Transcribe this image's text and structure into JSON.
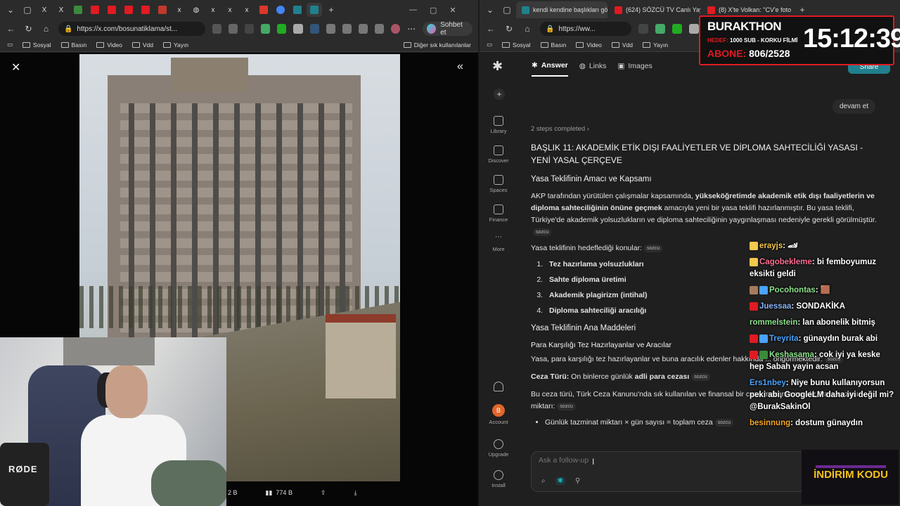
{
  "left_browser": {
    "tabs": [
      "X",
      "X",
      "U",
      "D",
      "K",
      "U",
      "R",
      "x",
      "x",
      "x",
      "x",
      "x",
      "A",
      "G",
      "(",
      "("
    ],
    "url": "https://x.com/bosunatiklama/st...",
    "copilot_label": "Sohbet et",
    "bookmarks": [
      "Sosyal",
      "Basın",
      "Video",
      "Vdd",
      "Yayın"
    ],
    "bookmarks_right": "Diğer sık kullanılanlar",
    "bottom_stats": {
      "stat1": "2 B",
      "views": "774 B"
    }
  },
  "right_browser": {
    "tabs": [
      {
        "title": "kendi kendine başlıkları gö",
        "color": "#20808d"
      },
      {
        "title": "(624) SÖZCÜ TV Canlı Yayı",
        "color": "#e01b22"
      },
      {
        "title": "(8) X'te Volkan: \"CV'e foto e",
        "color": "#e01b22"
      }
    ],
    "url": "https://ww...",
    "bookmarks": [
      "Sosyal",
      "Basın",
      "Video",
      "Vdd",
      "Yayın"
    ]
  },
  "sidebar": [
    {
      "label": "Library",
      "icon": "library-icon"
    },
    {
      "label": "Discover",
      "icon": "discover-icon"
    },
    {
      "label": "Spaces",
      "icon": "spaces-icon"
    },
    {
      "label": "Finance",
      "icon": "finance-icon"
    },
    {
      "label": "More",
      "icon": "more-icon"
    },
    {
      "label": "Account",
      "icon": "account-icon"
    },
    {
      "label": "Upgrade",
      "icon": "upgrade-icon"
    },
    {
      "label": "Install",
      "icon": "install-icon"
    }
  ],
  "avatar_letter": "B",
  "main_tabs": [
    "Answer",
    "Links",
    "Images"
  ],
  "share_label": "Share",
  "user_query": "devam et",
  "steps_label": "2 steps completed",
  "answer": {
    "title": "BAŞLIK 11: AKADEMİK ETİK DIŞI FAALİYETLER VE DİPLOMA SAHTECİLİĞİ YASASI - YENİ YASAL ÇERÇEVE",
    "h_purpose": "Yasa Teklifinin Amacı ve Kapsamı",
    "p1_a": "AKP tarafından yürütülen çalışmalar kapsamında, ",
    "p1_b": "yükseköğretimde akademik etik dışı faaliyetlerin ve diploma sahteciliğinin önüne geçmek",
    "p1_c": " amacıyla yeni bir yasa teklifi hazırlanmıştır. Bu yasa teklifi, Türkiye'de akademik yolsuzlukların ve diploma sahteciliğinin yaygınlaşması nedeniyle gerekli görülmüştür.",
    "cite": "sozcu",
    "p2": "Yasa teklifinin hedeflediği konular:",
    "targets": [
      "Tez hazırlama yolsuzlukları",
      "Sahte diploma üretimi",
      "Akademik plagirizm (intihal)",
      "Diploma sahteciliği aracılığı"
    ],
    "h_articles": "Yasa Teklifinin Ana Maddeleri",
    "h_paid": "Para Karşılığı Tez Hazırlayanlar ve Aracılar",
    "p3": "Yasa, para karşılığı tez hazırlayanlar ve buna aracılık edenler hakkında ... öngörmektedir:",
    "p4_label": "Ceza Türü:",
    "p4_a": " On binlerce günlük ",
    "p4_b": "adli para cezası",
    "p5": "Bu ceza türü, Türk Ceza Kanunu'nda sık kullanılan ve finansal bir ceza mekanizmasıdır. Para cezası miktarı:",
    "bullet": "Günlük tazminat miktarı × gün sayısı = toplam ceza"
  },
  "ask_placeholder": "Ask a follow-up",
  "chat": [
    {
      "user": "erayjs",
      "color": "#f2c94c",
      "text": "🏎"
    },
    {
      "user": "Cagobekleme",
      "color": "#ff6f91",
      "text": "bi femboyumuz eksikti geldi"
    },
    {
      "user": "Pocohontas",
      "color": "#8be28b",
      "text": "🟫"
    },
    {
      "user": "Juessaa",
      "color": "#8ab4f8",
      "text": "SONDAKİKA"
    },
    {
      "user": "rommelstein",
      "color": "#8be28b",
      "text": "lan abonelik bitmiş"
    },
    {
      "user": "Treyrita",
      "color": "#4aa3ff",
      "text": "günaydın burak abi"
    },
    {
      "user": "Keshasama",
      "color": "#8be28b",
      "text": "cok iyi ya keske hep Sabah yayin acsan"
    },
    {
      "user": "Ers1nbey",
      "color": "#4aa3ff",
      "text": "Niye bunu kullanıyorsun peki abi, GoogleLM daha iyi değil mi? @BurakSakinOl"
    },
    {
      "user": "besinnung",
      "color": "#f5a623",
      "text": "dostum günaydın"
    }
  ],
  "overlay": {
    "title": "BURAKTHON",
    "hedef_label": "HEDEF:",
    "hedef_text": "1000 SUB - KORKU FİLMİ",
    "abone_label": "ABONE:",
    "abone_value": "806/2528",
    "clock": "15:12:39"
  },
  "promo": "İNDİRİM KODU",
  "webcam_label": "RØDE",
  "colors": {
    "accent": "#20808d",
    "overlay_red": "#e01b22",
    "promo_yellow": "#f6c21a"
  }
}
